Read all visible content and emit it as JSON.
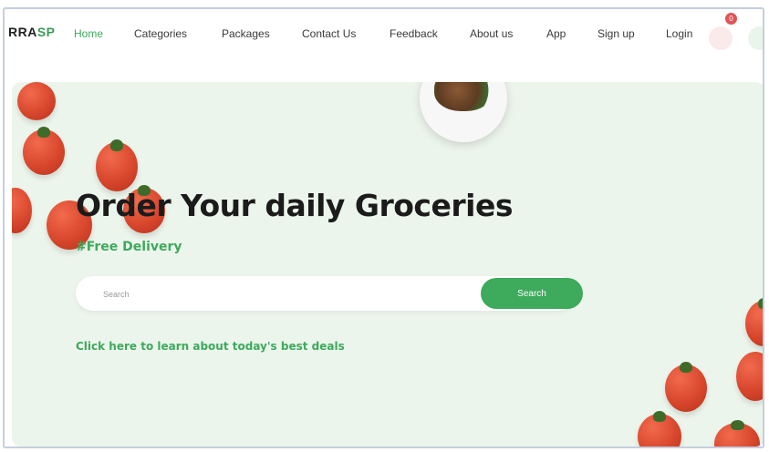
{
  "nav": {
    "logo_prefix": "RRA",
    "logo_suffix": "SP",
    "items": [
      {
        "label": "Home",
        "active": true
      },
      {
        "label": "Categories"
      },
      {
        "label": "Packages"
      },
      {
        "label": "Contact Us"
      },
      {
        "label": "Feedback"
      },
      {
        "label": "About us"
      },
      {
        "label": "App"
      },
      {
        "label": "Sign up"
      },
      {
        "label": "Login"
      }
    ],
    "cart_count": "0",
    "user_badge": "0",
    "cart_icon": "cart-icon",
    "user_icon": "user-icon"
  },
  "hero": {
    "headline": "Order Your daily Groceries",
    "subhead": "#Free Delivery",
    "search": {
      "placeholder": "Search",
      "value": "",
      "button_label": "Search"
    },
    "deals_link": "Click here to learn about today's best deals"
  },
  "colors": {
    "accent": "#3daa5c",
    "hero_bg": "#ecf5ec",
    "headline": "#1b1b1b",
    "badge_red": "#e05555"
  }
}
